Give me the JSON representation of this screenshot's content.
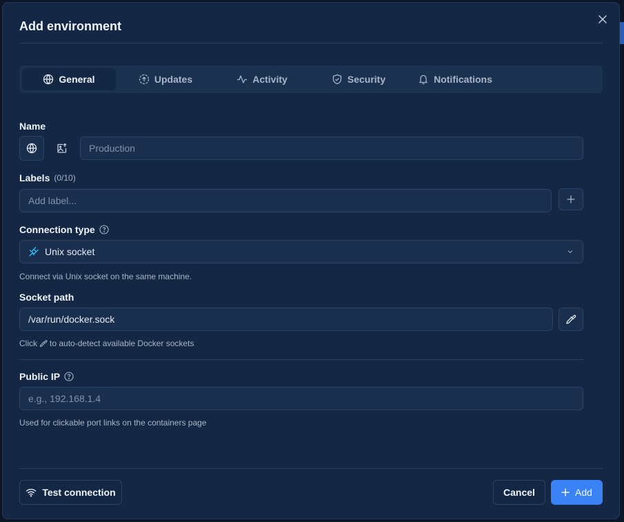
{
  "dialog": {
    "title": "Add environment"
  },
  "tabs": [
    {
      "label": "General",
      "icon": "globe-icon",
      "active": true
    },
    {
      "label": "Updates",
      "icon": "circle-arrow-up-icon",
      "active": false
    },
    {
      "label": "Activity",
      "icon": "activity-icon",
      "active": false
    },
    {
      "label": "Security",
      "icon": "shield-check-icon",
      "active": false
    },
    {
      "label": "Notifications",
      "icon": "bell-icon",
      "active": false
    }
  ],
  "name": {
    "label": "Name",
    "placeholder": "Production",
    "value": ""
  },
  "labels": {
    "label": "Labels",
    "count": "(0/10)",
    "placeholder": "Add label..."
  },
  "connection": {
    "label": "Connection type",
    "selected": "Unix socket",
    "hint": "Connect via Unix socket on the same machine."
  },
  "socket": {
    "label": "Socket path",
    "value": "/var/run/docker.sock",
    "hint_prefix": "Click",
    "hint_suffix": "to auto-detect available Docker sockets"
  },
  "public_ip": {
    "label": "Public IP",
    "placeholder": "e.g., 192.168.1.4",
    "hint": "Used for clickable port links on the containers page"
  },
  "footer": {
    "test_label": "Test connection",
    "cancel_label": "Cancel",
    "add_label": "Add"
  },
  "colors": {
    "accent": "#3b82f6",
    "background": "#142744",
    "field": "#1a2f4e"
  }
}
